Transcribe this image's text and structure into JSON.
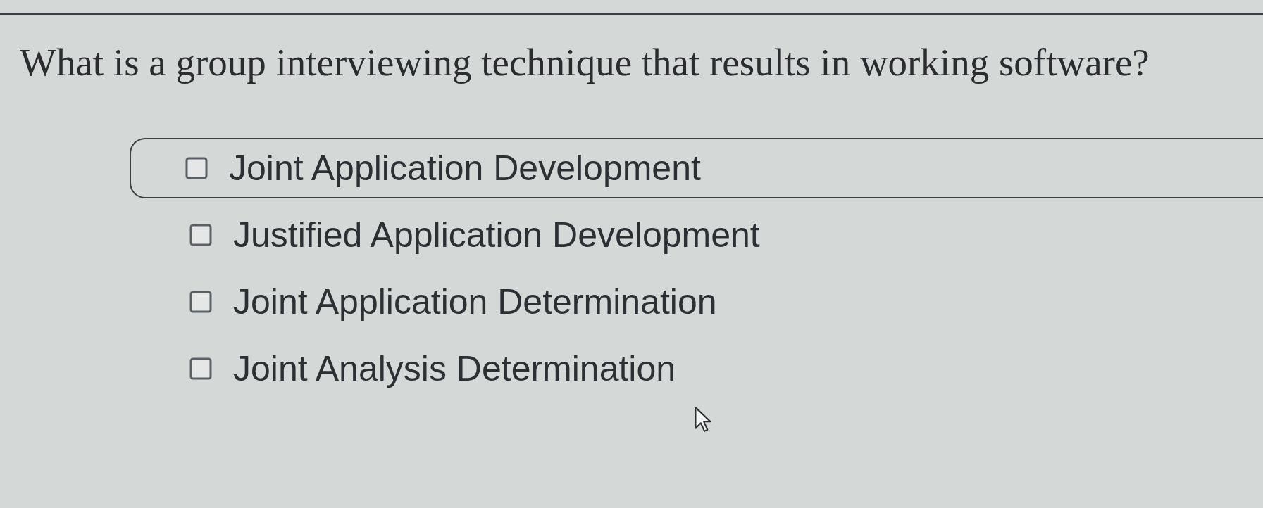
{
  "question": "What is a group interviewing technique that results in working software?",
  "options": [
    {
      "label": "Joint Application Development",
      "checked": false,
      "highlighted": true
    },
    {
      "label": "Justified Application Development",
      "checked": false,
      "highlighted": false
    },
    {
      "label": "Joint Application Determination",
      "checked": false,
      "highlighted": false
    },
    {
      "label": "Joint Analysis Determination",
      "checked": false,
      "highlighted": false
    }
  ]
}
